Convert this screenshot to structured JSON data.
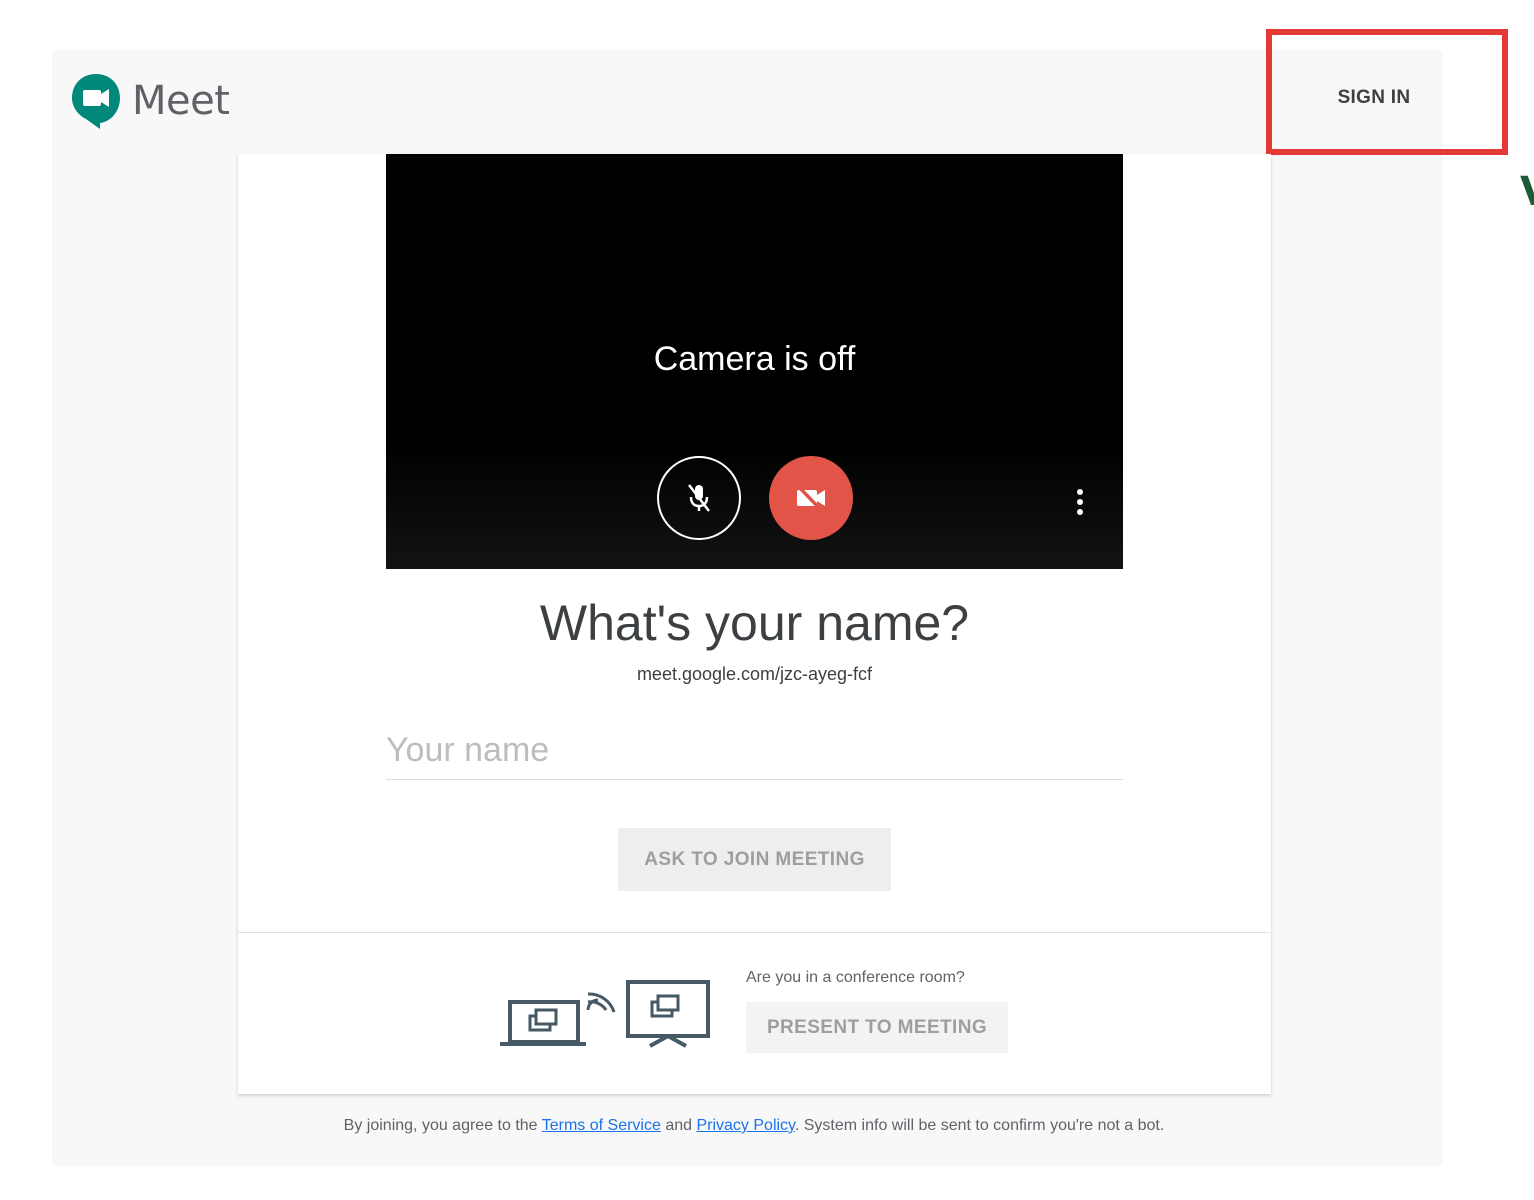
{
  "app": {
    "name": "Meet"
  },
  "header": {
    "sign_in_label": "SIGN IN"
  },
  "annotation": {
    "highlight_color": "#e53935",
    "edge_glyph": "V"
  },
  "preview": {
    "status_text": "Camera is off",
    "mic_icon": "mic-off-icon",
    "camera_icon": "videocam-off-icon",
    "camera_button_color": "#e25447",
    "more_icon": "more-vert-icon"
  },
  "join": {
    "heading": "What's your name?",
    "meeting_url": "meet.google.com/jzc-ayeg-fcf",
    "name_placeholder": "Your name",
    "ask_button_label": "ASK TO JOIN MEETING"
  },
  "conference": {
    "question": "Are you in a conference room?",
    "present_button_label": "PRESENT TO MEETING",
    "illustration_icon": "cast-to-screen-icon"
  },
  "footer": {
    "prefix": "By joining, you agree to the ",
    "terms_label": "Terms of Service",
    "and_text": " and ",
    "privacy_label": "Privacy Policy",
    "suffix": ". System info will be sent to confirm you're not a bot.",
    "link_color": "#1a73e8"
  }
}
